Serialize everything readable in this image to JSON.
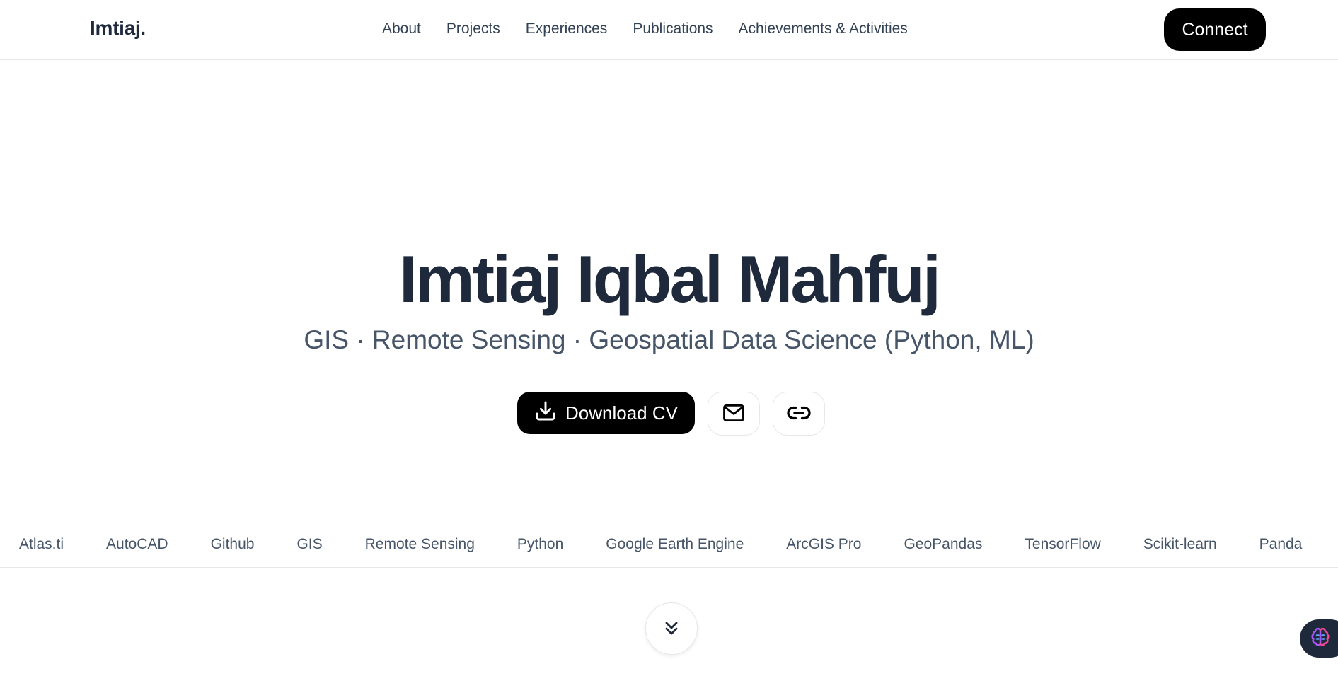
{
  "header": {
    "brand": "Imtiaj.",
    "nav": [
      "About",
      "Projects",
      "Experiences",
      "Publications",
      "Achievements & Activities"
    ],
    "connect_label": "Connect"
  },
  "hero": {
    "name": "Imtiaj Iqbal Mahfuj",
    "subtitle": "GIS · Remote Sensing · Geospatial Data Science (Python, ML)",
    "download_label": "Download CV",
    "download_icon": "download-icon",
    "email_icon": "mail-icon",
    "link_icon": "link-icon"
  },
  "skills": [
    "Atlas.ti",
    "AutoCAD",
    "Github",
    "GIS",
    "Remote Sensing",
    "Python",
    "Google Earth Engine",
    "ArcGIS Pro",
    "GeoPandas",
    "TensorFlow",
    "Scikit-learn",
    "Panda"
  ],
  "scroll": {
    "icon": "chevrons-down-icon"
  },
  "widget": {
    "icon": "brain-icon"
  }
}
